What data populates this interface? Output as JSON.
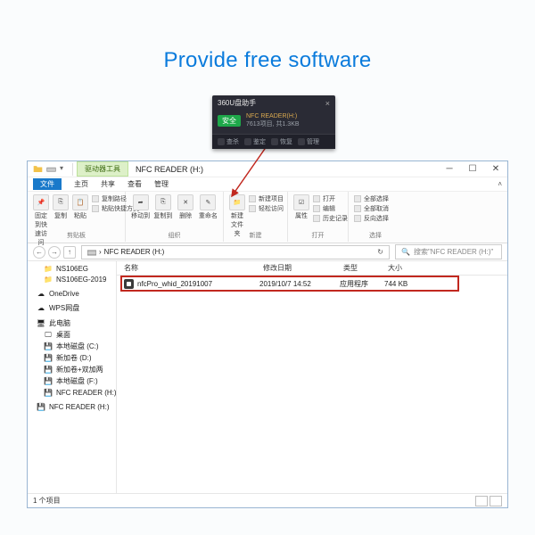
{
  "headline": "Provide free software",
  "popup": {
    "title": "360U盘助手",
    "badge": "安全",
    "line1": "NFC READER(H:)",
    "line2": "7613项目, 共1.3KB",
    "tools": [
      "查杀",
      "鉴定",
      "恢复",
      "管理"
    ]
  },
  "titlebar": {
    "tab_group": "驱动器工具",
    "title": "NFC READER (H:)"
  },
  "menubar": {
    "file": "文件",
    "home": "主页",
    "share": "共享",
    "view": "查看",
    "manage": "管理"
  },
  "ribbon": {
    "pin": "固定到快\n速访问",
    "copy": "复制",
    "paste": "粘贴",
    "copy_path": "复制路径",
    "paste_shortcut": "粘贴快捷方式",
    "moveto": "移动到",
    "copyto": "复制到",
    "delete": "删除",
    "rename": "重命名",
    "newfolder": "新建\n文件夹",
    "new_item": "新建项目",
    "easy_access": "轻松访问",
    "properties": "属性",
    "open": "打开",
    "edit": "编辑",
    "history": "历史记录",
    "select_all": "全部选择",
    "select_none": "全部取消",
    "invert": "反向选择",
    "grp_clipboard": "剪贴板",
    "grp_organize": "组织",
    "grp_new": "新建",
    "grp_open": "打开",
    "grp_select": "选择"
  },
  "address": {
    "path": "NFC READER (H:)",
    "search_placeholder": "搜索\"NFC READER (H:)\""
  },
  "columns": {
    "name": "名称",
    "date": "修改日期",
    "type": "类型",
    "size": "大小"
  },
  "file": {
    "name": "nfcPro_whid_20191007",
    "date": "2019/10/7 14:52",
    "type": "应用程序",
    "size": "744 KB"
  },
  "sidebar": {
    "items1": [
      "NS106EG",
      "NS106EG-2019"
    ],
    "onedrive": "OneDrive",
    "wps": "WPS网盘",
    "thispc": "此电脑",
    "sub": [
      "桌面",
      "本地磁盘 (C:)",
      "新加卷 (D:)",
      "新加卷+双加两",
      "本地磁盘 (F:)",
      "NFC READER (H:)"
    ],
    "removable": "NFC READER (H:)"
  },
  "status": {
    "count": "1 个项目"
  }
}
